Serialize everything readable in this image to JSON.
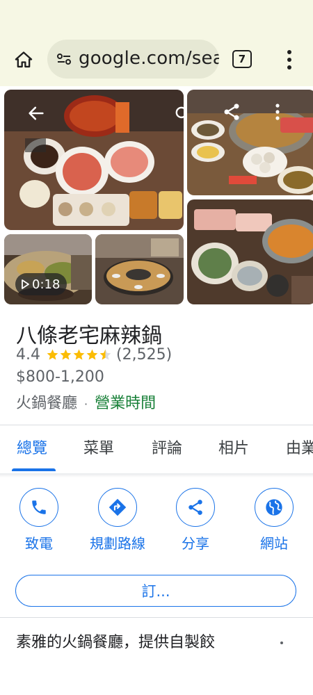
{
  "browser": {
    "url": "google.com/sea",
    "tab_count": "7",
    "icons": [
      "home-icon",
      "site-info-icon",
      "tab-switcher-icon",
      "more-vert-icon"
    ]
  },
  "photos": {
    "video_duration": "0:18",
    "overlay_icons": [
      "back-arrow-icon",
      "search-icon",
      "share-icon",
      "more-vert-icon"
    ]
  },
  "place": {
    "name": "八條老宅麻辣鍋",
    "rating": "4.4",
    "rating_value": 4.4,
    "reviews": "(2,525)",
    "price": "$800-1,200",
    "category": "火鍋餐廳",
    "separator": "·",
    "hours": "營業時間"
  },
  "tabs": [
    "總覽",
    "菜單",
    "評論",
    "相片",
    "由業"
  ],
  "actions": [
    {
      "label": "致電",
      "icon": "phone-icon"
    },
    {
      "label": "規劃路線",
      "icon": "directions-icon"
    },
    {
      "label": "分享",
      "icon": "share-icon"
    },
    {
      "label": "網站",
      "icon": "globe-icon"
    }
  ],
  "reserve_label": "訂...",
  "description": "素雅的火鍋餐廳，提供自製餃",
  "colors": {
    "accent": "#1a73e8",
    "open": "#188038",
    "star": "#fbbc04",
    "chrome_bg": "#f6f7e4"
  }
}
